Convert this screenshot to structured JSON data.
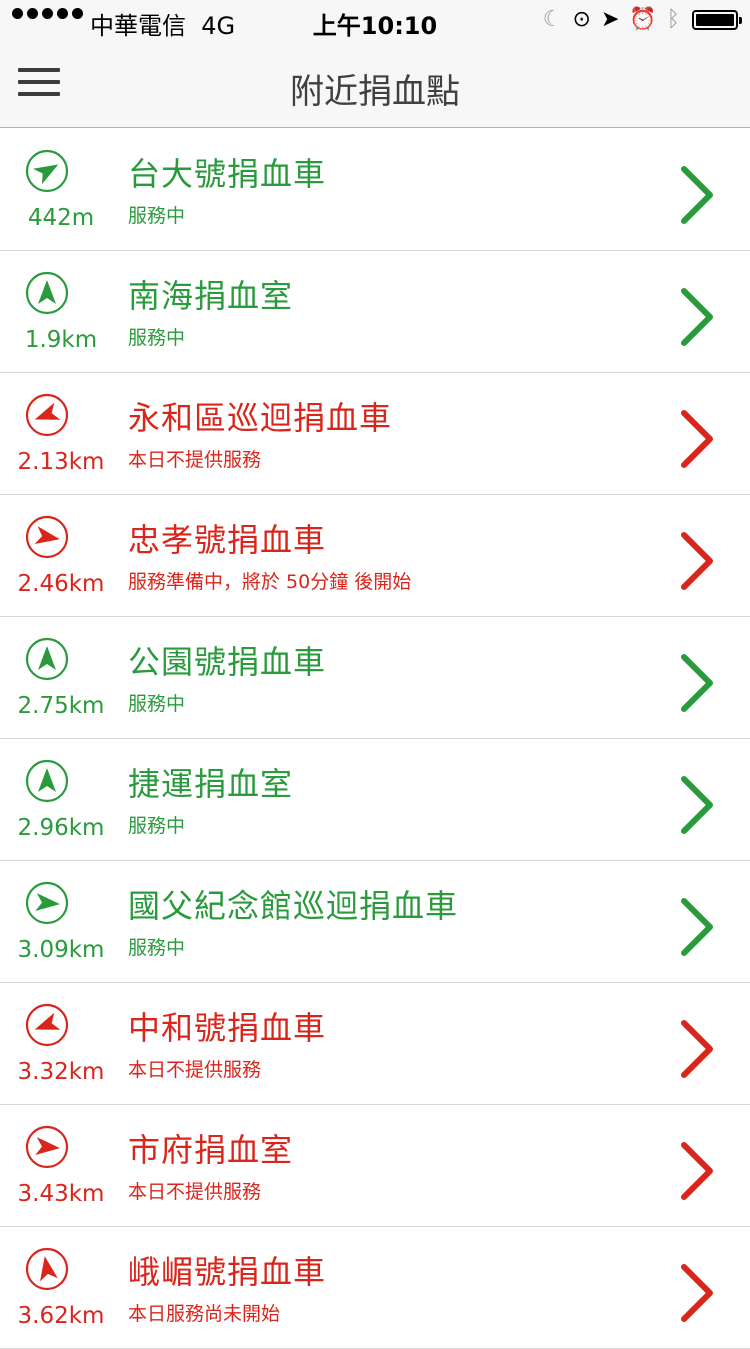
{
  "status_bar": {
    "carrier": "中華電信",
    "network": "4G",
    "time": "上午10:10"
  },
  "nav": {
    "title": "附近捐血點",
    "menu_icon": "hamburger-menu-icon"
  },
  "colors": {
    "available": "#2a9b3d",
    "unavailable": "#d9261c"
  },
  "sites": [
    {
      "name": "台大號捐血車",
      "status": "服務中",
      "distance": "442m",
      "state": "green",
      "bearing_deg": 60,
      "icon": "direction-arrow-icon"
    },
    {
      "name": "南海捐血室",
      "status": "服務中",
      "distance": "1.9km",
      "state": "green",
      "bearing_deg": 0,
      "icon": "direction-arrow-icon"
    },
    {
      "name": "永和區巡迴捐血車",
      "status": "本日不提供服務",
      "distance": "2.13km",
      "state": "red",
      "bearing_deg": 250,
      "icon": "direction-arrow-icon"
    },
    {
      "name": "忠孝號捐血車",
      "status": "服務準備中，將於 50分鐘 後開始",
      "distance": "2.46km",
      "state": "red",
      "bearing_deg": 100,
      "icon": "direction-arrow-icon"
    },
    {
      "name": "公園號捐血車",
      "status": "服務中",
      "distance": "2.75km",
      "state": "green",
      "bearing_deg": 0,
      "icon": "direction-arrow-icon"
    },
    {
      "name": "捷運捐血室",
      "status": "服務中",
      "distance": "2.96km",
      "state": "green",
      "bearing_deg": 0,
      "icon": "direction-arrow-icon"
    },
    {
      "name": "國父紀念館巡迴捐血車",
      "status": "服務中",
      "distance": "3.09km",
      "state": "green",
      "bearing_deg": 95,
      "icon": "direction-arrow-icon"
    },
    {
      "name": "中和號捐血車",
      "status": "本日不提供服務",
      "distance": "3.32km",
      "state": "red",
      "bearing_deg": 250,
      "icon": "direction-arrow-icon"
    },
    {
      "name": "市府捐血室",
      "status": "本日不提供服務",
      "distance": "3.43km",
      "state": "red",
      "bearing_deg": 95,
      "icon": "direction-arrow-icon"
    },
    {
      "name": "峨嵋號捐血車",
      "status": "本日服務尚未開始",
      "distance": "3.62km",
      "state": "red",
      "bearing_deg": 350,
      "icon": "direction-arrow-icon"
    }
  ]
}
